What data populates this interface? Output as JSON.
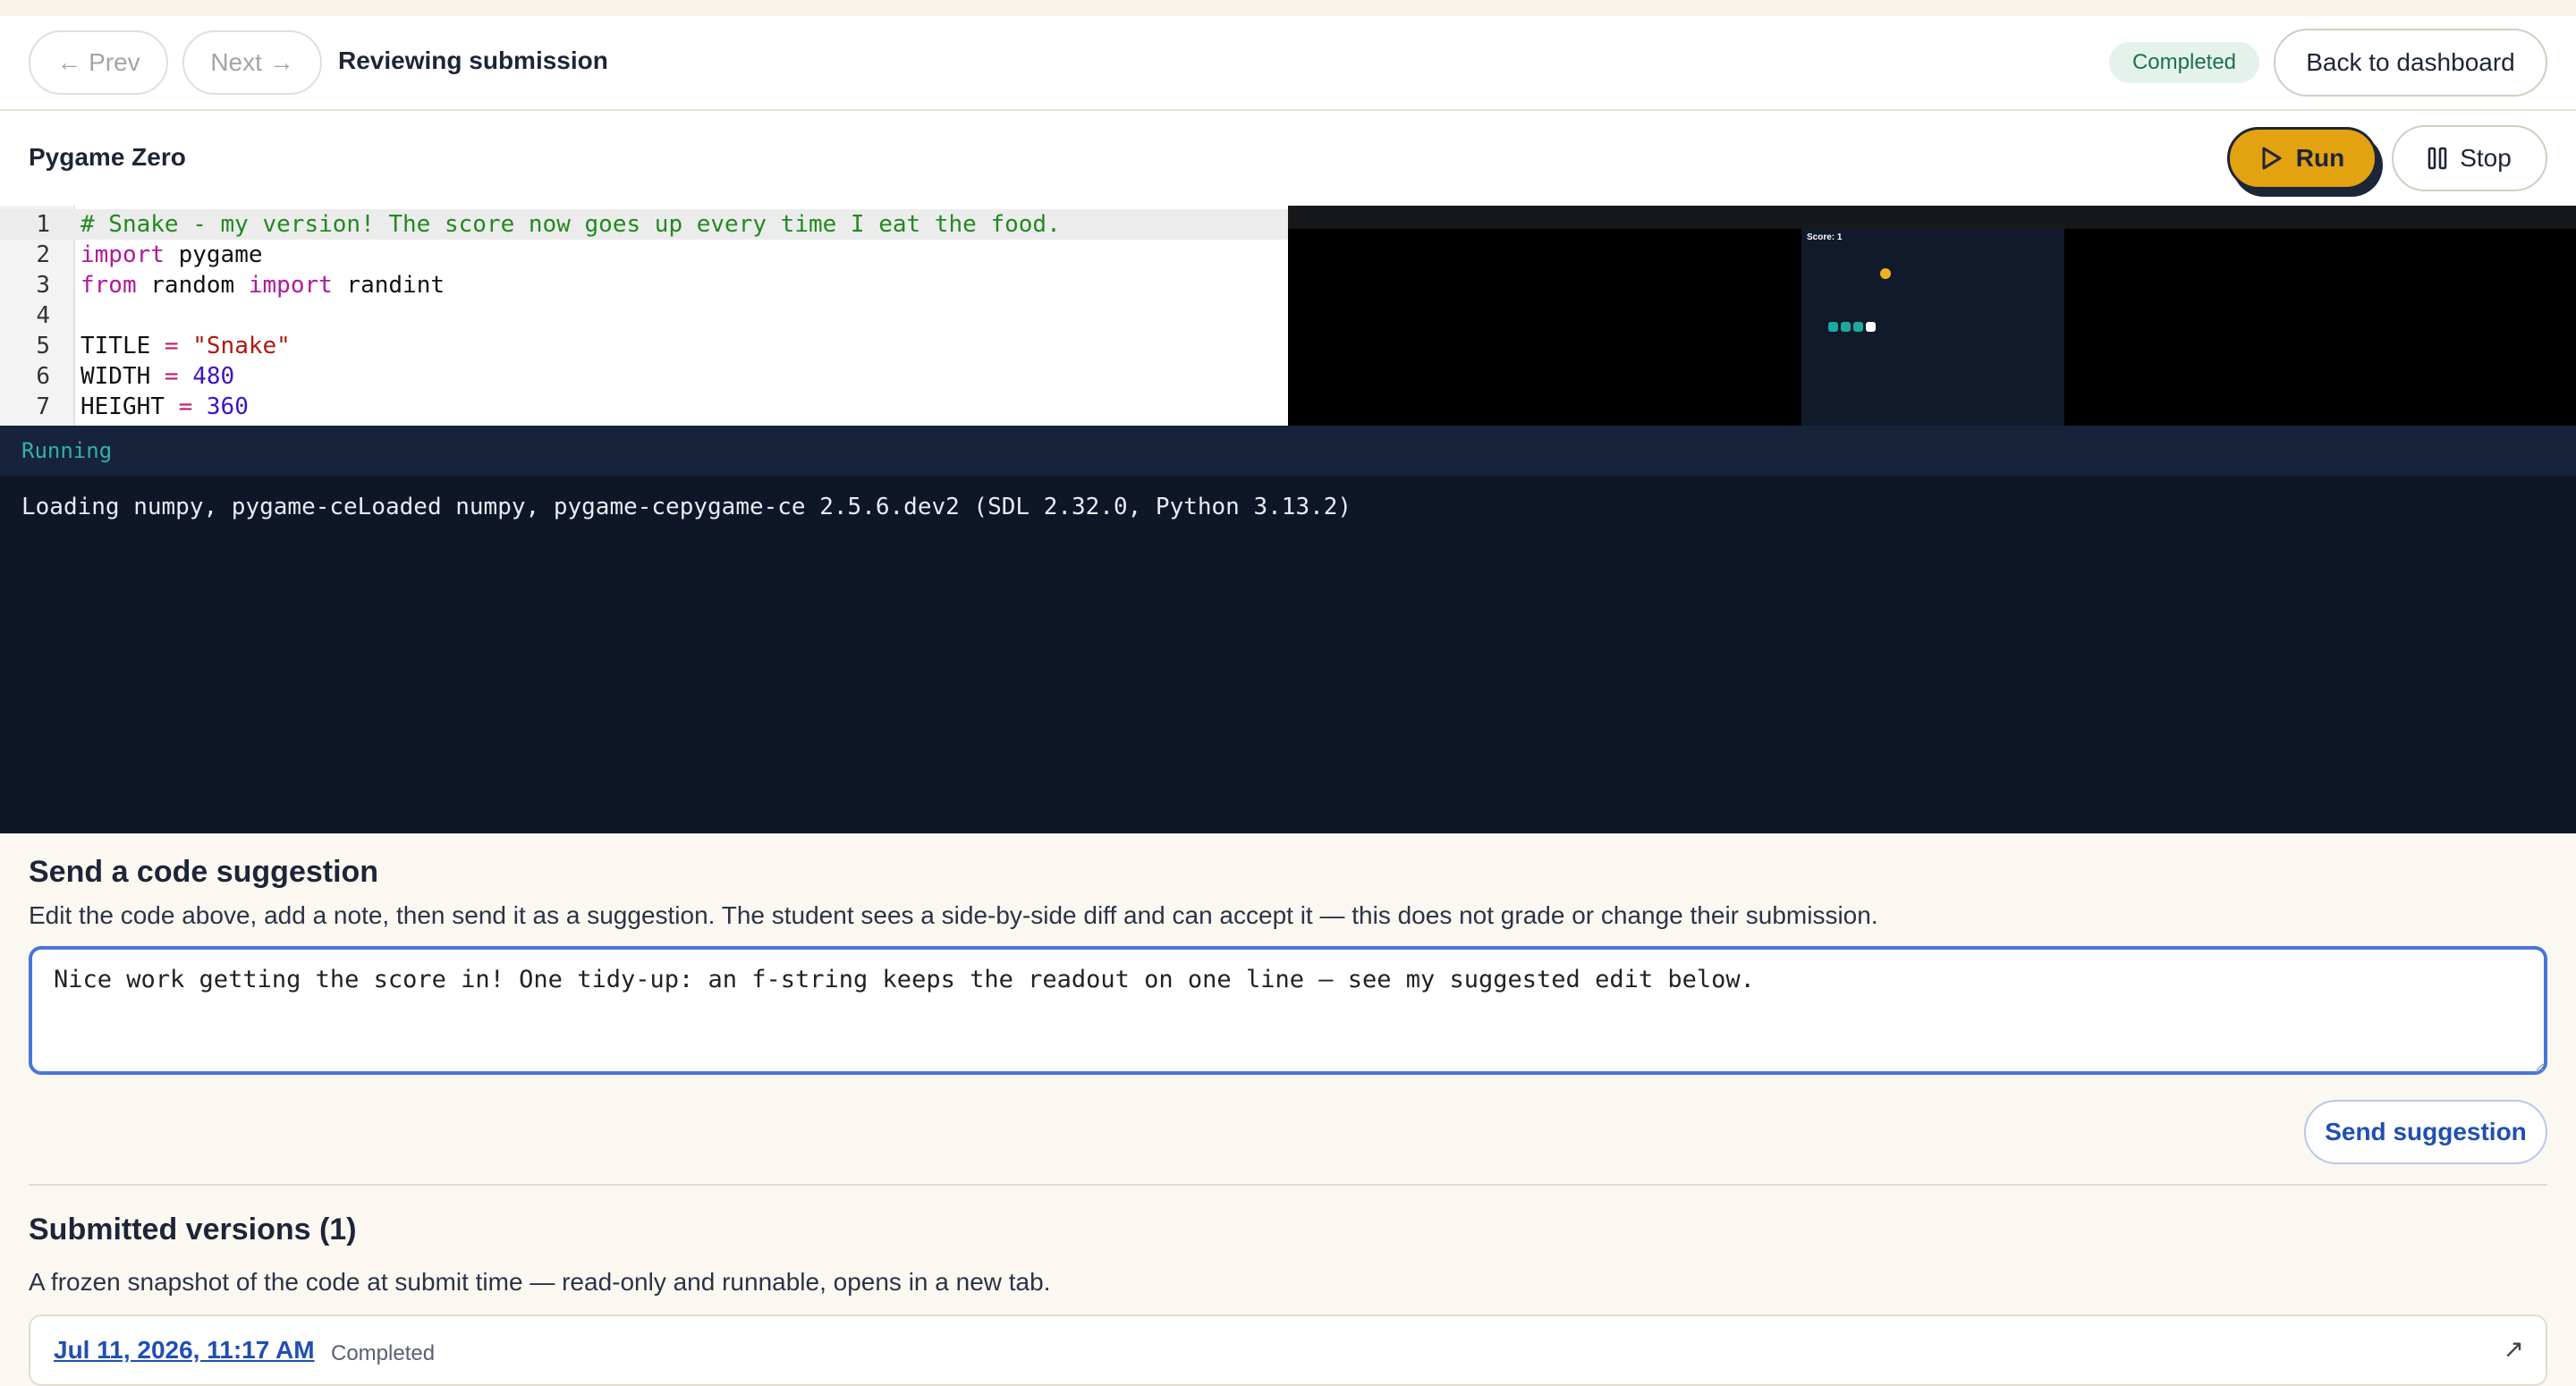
{
  "nav": {
    "prev_label": "← Prev",
    "next_label": "Next →",
    "title": "Reviewing submission",
    "status_badge": "Completed",
    "back_label": "Back to dashboard"
  },
  "project": {
    "name": "Pygame Zero",
    "run_label": "Run",
    "stop_label": "Stop"
  },
  "editor": {
    "lines": [
      {
        "n": "1",
        "tokens": [
          {
            "t": "cm",
            "v": "# Snake - my version! The score now goes up every time I eat the food."
          }
        ]
      },
      {
        "n": "2",
        "tokens": [
          {
            "t": "kw",
            "v": "import"
          },
          {
            "t": "",
            "v": " pygame"
          }
        ]
      },
      {
        "n": "3",
        "tokens": [
          {
            "t": "kw",
            "v": "from"
          },
          {
            "t": "",
            "v": " random "
          },
          {
            "t": "kw",
            "v": "import"
          },
          {
            "t": "",
            "v": " randint"
          }
        ]
      },
      {
        "n": "4",
        "tokens": []
      },
      {
        "n": "5",
        "tokens": [
          {
            "t": "",
            "v": "TITLE "
          },
          {
            "t": "op",
            "v": "="
          },
          {
            "t": "",
            "v": " "
          },
          {
            "t": "str",
            "v": "\"Snake\""
          }
        ]
      },
      {
        "n": "6",
        "tokens": [
          {
            "t": "",
            "v": "WIDTH "
          },
          {
            "t": "op",
            "v": "="
          },
          {
            "t": "",
            "v": " "
          },
          {
            "t": "num",
            "v": "480"
          }
        ]
      },
      {
        "n": "7",
        "tokens": [
          {
            "t": "",
            "v": "HEIGHT "
          },
          {
            "t": "op",
            "v": "="
          },
          {
            "t": "",
            "v": " "
          },
          {
            "t": "num",
            "v": "360"
          }
        ]
      }
    ]
  },
  "game": {
    "score_text": "Score: 1",
    "colors": {
      "food": "#f0b31e",
      "snake_body": "#1ea99e",
      "snake_head": "#ffffff",
      "background": "#111a2b"
    }
  },
  "console": {
    "status": "Running",
    "output": "Loading numpy, pygame-ceLoaded numpy, pygame-cepygame-ce 2.5.6.dev2 (SDL 2.32.0, Python 3.13.2)"
  },
  "suggestion": {
    "heading": "Send a code suggestion",
    "description": "Edit the code above, add a note, then send it as a suggestion. The student sees a side-by-side diff and can accept it — this does not grade or change their submission.",
    "note_value": "Nice work getting the score in! One tidy-up: an f-string keeps the readout on one line — see my suggested edit below.",
    "send_label": "Send suggestion"
  },
  "versions": {
    "heading": "Submitted versions (1)",
    "description": "A frozen snapshot of the code at submit time — read-only and runnable, opens in a new tab.",
    "items": [
      {
        "date": "Jul 11, 2026, 11:17 AM",
        "status": "Completed"
      }
    ]
  }
}
